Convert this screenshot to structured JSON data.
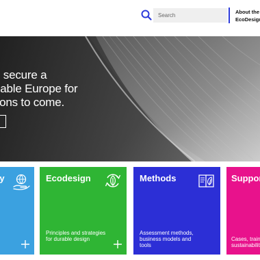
{
  "header": {
    "search_placeholder": "Search",
    "about_line1": "About the g",
    "about_line2": "EcoDesign C"
  },
  "hero": {
    "heading_line1": "o secure a",
    "heading_line2": "nable Europe for",
    "heading_line3": "tions to come."
  },
  "cards": [
    {
      "title": "ty",
      "description": "",
      "color": "#3ba1e0",
      "icon": "globe-hand-icon"
    },
    {
      "title": "Ecodesign",
      "description": "Principles and strategies for durable design",
      "color": "#2fb534",
      "icon": "recycle-leaf-icon"
    },
    {
      "title": "Methods",
      "description": "Assessment methods, business models and tools",
      "color": "#2c2fd6",
      "icon": "book-leaf-icon"
    },
    {
      "title": "Suppor",
      "description": "Cases, traini sustainabilit",
      "color": "#e8128c",
      "icon": ""
    }
  ],
  "colors": {
    "accent": "#2c3adb"
  }
}
